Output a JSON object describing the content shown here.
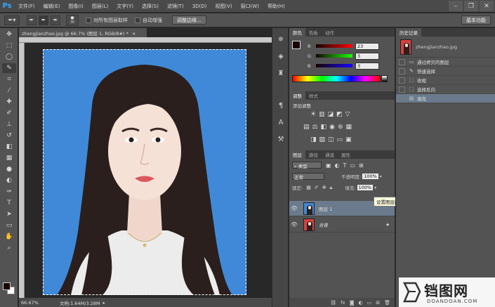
{
  "app": {
    "logo": "Ps"
  },
  "menu": [
    "文件(F)",
    "编辑(E)",
    "图像(I)",
    "图层(L)",
    "文字(Y)",
    "选择(S)",
    "滤镜(T)",
    "3D(D)",
    "视图(V)",
    "窗口(W)",
    "帮助(H)"
  ],
  "window_controls": [
    "minimize",
    "restore",
    "close"
  ],
  "options": {
    "brush_size": "30",
    "sample_all_label": "对所有图层取样",
    "auto_enhance_label": "自动增强",
    "refine_edge_label": "调整边缘...",
    "workspace_label": "基本功能"
  },
  "tools": [
    "move-icon",
    "marquee-icon",
    "lasso-icon",
    "quick-select-icon",
    "crop-icon",
    "eyedropper-icon",
    "healing-icon",
    "brush-icon",
    "stamp-icon",
    "history-brush-icon",
    "eraser-icon",
    "gradient-icon",
    "blur-icon",
    "dodge-icon",
    "pen-icon",
    "type-icon",
    "path-select-icon",
    "shape-icon",
    "hand-icon",
    "zoom-icon"
  ],
  "document": {
    "tab_title": "zhengjianzhao.jpg @ 66.7% (图层 1, RGB/8#) *",
    "zoom": "66.67%",
    "doc_info": "文档:1.64M/3.28M"
  },
  "color_panel": {
    "tabs": [
      "颜色",
      "色板",
      "动作"
    ],
    "active_tab": "颜色",
    "sliders": [
      {
        "label": "R",
        "value": "23"
      },
      {
        "label": "G",
        "value": "3"
      },
      {
        "label": "B",
        "value": "3"
      }
    ],
    "fg_color": "#170303"
  },
  "adjust_panel": {
    "tabs": [
      "调整",
      "样式"
    ],
    "active_tab": "调整",
    "add_label": "添加调整"
  },
  "layers_panel": {
    "tabs": [
      "图层",
      "路径",
      "通道",
      "属性"
    ],
    "active_tab": "图层",
    "kind_label": "类型",
    "blend_mode": "正常",
    "opacity_label": "不透明度:",
    "opacity_value": "100%",
    "lock_label": "锁定:",
    "fill_label": "填充:",
    "fill_value": "100%",
    "tooltip": "设置图层的内部不透明度",
    "layers": [
      {
        "name": "图层 1",
        "active": true
      },
      {
        "name": "背景",
        "active": false
      }
    ]
  },
  "history_panel": {
    "title": "历史记录",
    "snapshot": "zhengjianzhao.jpg",
    "items": [
      {
        "label": "通过拷贝的图层",
        "icon": "layer-icon",
        "active": false
      },
      {
        "label": "快速选择",
        "icon": "quick-select-icon",
        "active": false
      },
      {
        "label": "收缩",
        "icon": "selection-icon",
        "active": false
      },
      {
        "label": "选择反向",
        "icon": "selection-icon",
        "active": false
      },
      {
        "label": "填充",
        "icon": "fill-icon",
        "active": true
      }
    ]
  },
  "watermark": {
    "brand": "铛图网",
    "domain": "DOANDOAN.COM"
  }
}
